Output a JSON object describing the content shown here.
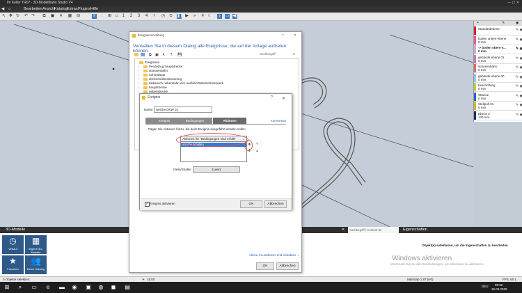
{
  "window": {
    "title": "Im Keller TR07 - 3D-Modellbahn Studio V4"
  },
  "menu": [
    "Bearbeiten",
    "Ansicht",
    "Katalog",
    "Extras",
    "Plugins",
    "Hilfe"
  ],
  "toolbar": {
    "numbers": [
      "1",
      "2",
      "3",
      "4",
      "+"
    ]
  },
  "layers": [
    {
      "name": "Standardebene",
      "value": "",
      "color": "#d8202a"
    },
    {
      "name": "boden untere ebene",
      "value": "0 mm",
      "color": "#e0608a"
    },
    {
      "name": "-> boden obere e...",
      "value": "0 mm",
      "color": "#c8b0d8"
    },
    {
      "name": "gebäude ebene 01",
      "value": "0 mm",
      "color": "#c878b8"
    },
    {
      "name": "strassenbahn",
      "value": "0 mm",
      "color": "#e06868"
    },
    {
      "name": "gebäude ebene 00",
      "value": "0 mm",
      "color": "#8ec8e0"
    },
    {
      "name": "beschriftung",
      "value": "0 mm",
      "color": "#b8d040"
    },
    {
      "name": "Strasse",
      "value": "0 mm",
      "color": "#3060c0"
    },
    {
      "name": "Stellpult 01",
      "value": "0 mm",
      "color": "#d0b830"
    },
    {
      "name": "Ebene 2",
      "value": "140 mm",
      "color": "#203060"
    }
  ],
  "main_dialog": {
    "title": "Ereignisverwaltung",
    "subtitle": "Verwalten Sie in diesem Dialog alle Ereignisse, die auf der Anlage auftreten können.",
    "search_placeholder": "Suchbegriff",
    "tree": [
      "Ereignisse",
      "Pendelzug hauptstrecke",
      "strassenbahn",
      "Schmalspur",
      "drehscheibensteuerung",
      "lokkausch nebenbahn ein/ ausfahrt Bahnbetriebswerk",
      "hauptstrecke",
      "nebenstrecke"
    ],
    "link": "Aktive Countdowns und Variablen →",
    "ok": "OK",
    "cancel": "Abbrechen",
    "help": "?"
  },
  "event_dialog": {
    "title": "Ereignis",
    "name_label": "Name:",
    "name_value": "weiche DKW 01",
    "tabs": [
      "Ereignis",
      "Bedingungen",
      "Aktionen"
    ],
    "comment": "Kommentar",
    "instruction": "Fügen Sie Aktionen hinzu, die beim Ereignis ausgeführt werden sollen.",
    "dropdown": "Aktionen für \"Bedingungen sind erfüllt\"",
    "list_item": "Weiche schalten",
    "street_label": "Gleis/Straße:",
    "street_value": "[Leer]",
    "checkbox_label": "Ereignis aktivieren",
    "ok": "OK",
    "cancel": "Abbrechen",
    "help": "?"
  },
  "bottom": {
    "models_title": "3D-Modelle",
    "tiles": [
      "Verlauf",
      "Eigene 3D-Modelle",
      "Favoriten",
      "Deine Katalog"
    ],
    "search_placeholder": "Suchbegriff / Content-ID",
    "props_title": "Eigenschaften",
    "props_text": "Objekt(e) selektieren, um die Eigenschaften zu bearbeiten",
    "watermark1": "Windows aktivieren",
    "watermark2": "Wechseln Sie zu den Einstellungen, um Windows zu aktivieren."
  },
  "status": {
    "left": "0 Objekte selektiert",
    "time": "15:00",
    "scale": "Maßstab 1:87 (H0)",
    "fps": "FPS: 60.1"
  },
  "taskbar": {
    "lang": "DEU",
    "clock": "09:32",
    "date": "15.03.2018"
  }
}
